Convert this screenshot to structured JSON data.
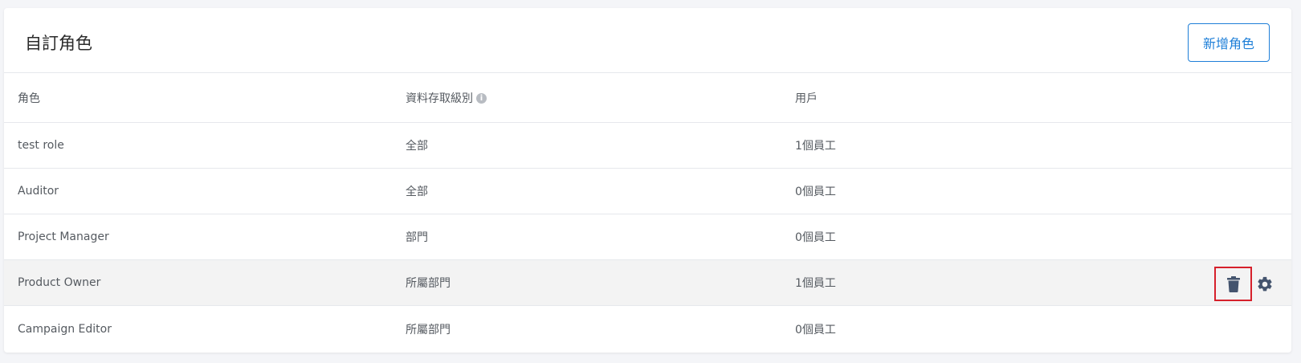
{
  "header": {
    "title": "自訂角色",
    "add_button_label": "新增角色"
  },
  "table": {
    "columns": {
      "role": "角色",
      "access_level": "資料存取級別",
      "users": "用戶"
    },
    "rows": [
      {
        "role": "test role",
        "access_level": "全部",
        "users": "1個員工"
      },
      {
        "role": "Auditor",
        "access_level": "全部",
        "users": "0個員工"
      },
      {
        "role": "Project Manager",
        "access_level": "部門",
        "users": "0個員工"
      },
      {
        "role": "Product Owner",
        "access_level": "所屬部門",
        "users": "1個員工"
      },
      {
        "role": "Campaign Editor",
        "access_level": "所屬部門",
        "users": "0個員工"
      }
    ]
  },
  "icons": {
    "info": "info-icon",
    "delete": "trash-icon",
    "settings": "gear-icon"
  },
  "colors": {
    "accent": "#1e7fd8",
    "highlight_border": "#d6202b",
    "icon_color": "#44546e"
  }
}
